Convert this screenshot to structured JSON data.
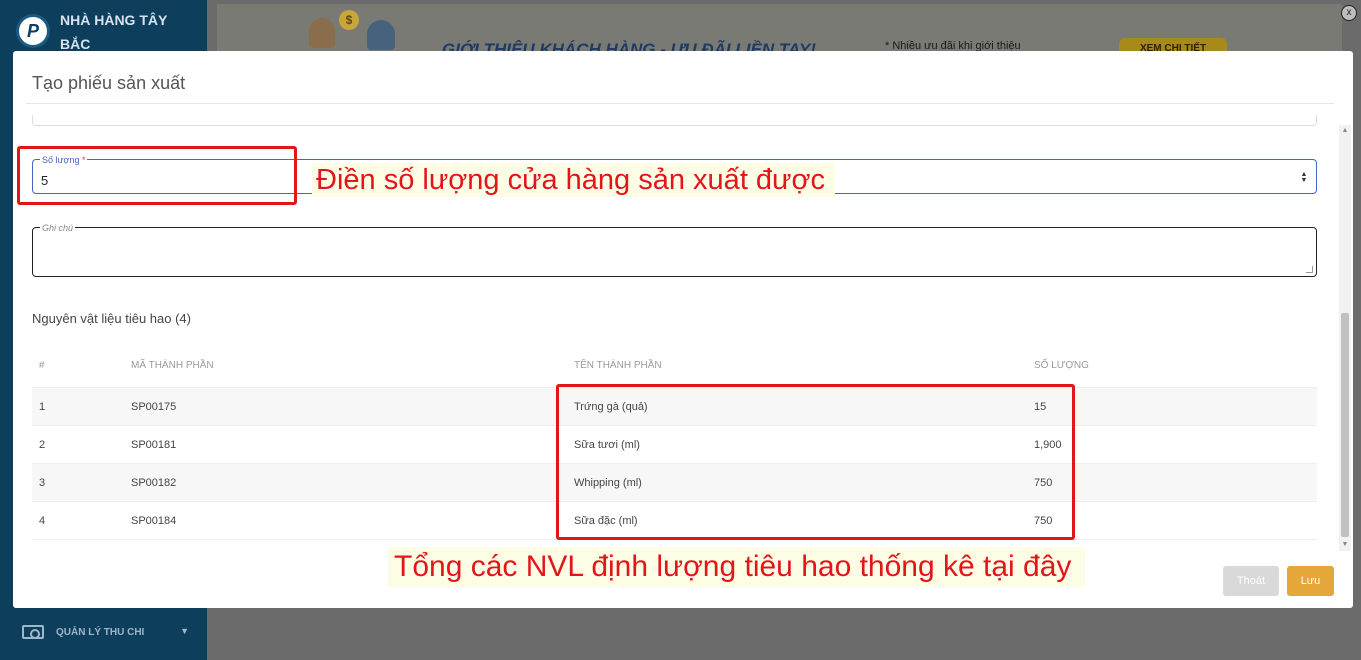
{
  "sidebar": {
    "brand_line1": "NHÀ HÀNG TÂY",
    "brand_line2": "BẮC",
    "logo_letter": "P",
    "bottom_item_label": "QUẢN LÝ THU CHI",
    "colors": {
      "background": "#0d3f5c"
    }
  },
  "promo": {
    "headline": "GIỚI THIỆU KHÁCH HÀNG - ƯU ĐÃI LIỀN TAY!",
    "note": "* Nhiều ưu đãi khi giới thiệu",
    "cta": "XEM CHI TIẾT",
    "coin_symbol": "$",
    "close_label": "x"
  },
  "modal": {
    "title": "Tạo phiếu sản xuất",
    "quantity_field": {
      "label": "Số lượng",
      "required_mark": "*",
      "value": "5"
    },
    "note_field": {
      "label": "Ghi chú",
      "value": ""
    },
    "materials_heading": "Nguyên vật liệu tiêu hao (4)",
    "table": {
      "headers": {
        "index": "#",
        "code": "MÃ THÀNH PHẦN",
        "name": "TÊN THÀNH PHẦN",
        "quantity": "SỐ LƯỢNG"
      },
      "rows": [
        {
          "index": "1",
          "code": "SP00175",
          "name": "Trứng gà (quả)",
          "quantity": "15"
        },
        {
          "index": "2",
          "code": "SP00181",
          "name": "Sữa tươi (ml)",
          "quantity": "1,900"
        },
        {
          "index": "3",
          "code": "SP00182",
          "name": "Whipping (ml)",
          "quantity": "750"
        },
        {
          "index": "4",
          "code": "SP00184",
          "name": "Sữa đặc (ml)",
          "quantity": "750"
        }
      ]
    },
    "buttons": {
      "exit": "Thoát",
      "save": "Lưu"
    }
  },
  "annotations": {
    "quantity_callout": "Điền số lượng cửa hàng sản xuất được",
    "table_callout": "Tổng các NVL định lượng tiêu hao thống kê tại đây",
    "highlight_color": "#e2151b"
  }
}
